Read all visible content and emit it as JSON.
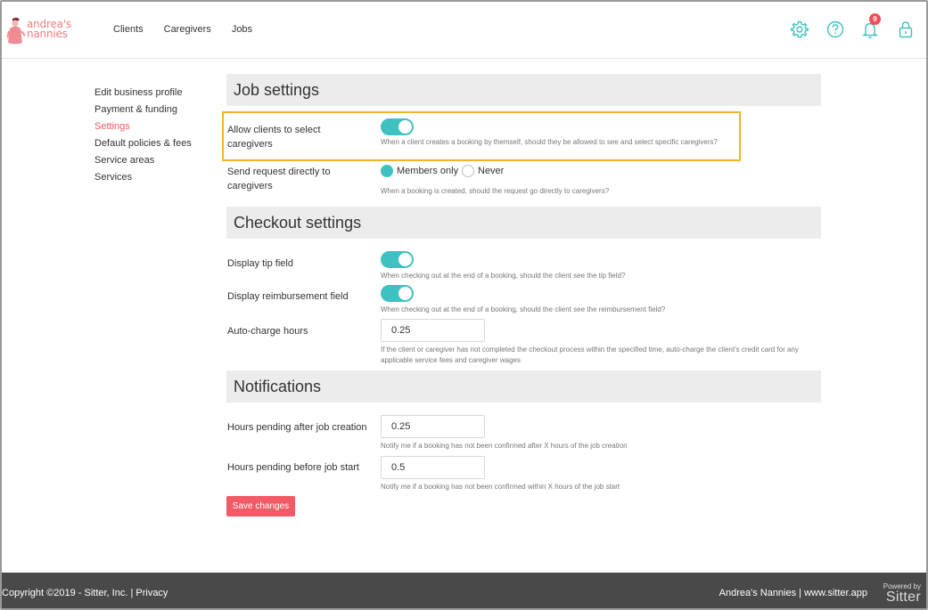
{
  "app": {
    "logo_text_1": "andrea's",
    "logo_text_2": "nannies"
  },
  "nav": {
    "items": [
      "Clients",
      "Caregivers",
      "Jobs"
    ]
  },
  "header": {
    "notification_count": "9",
    "icons": [
      "gear-icon",
      "help-icon",
      "bell-icon",
      "lock-icon"
    ],
    "accent": "#3ec1c0"
  },
  "sidebar": {
    "items": [
      {
        "label": "Edit business profile"
      },
      {
        "label": "Payment & funding"
      },
      {
        "label": "Settings",
        "active": true
      },
      {
        "label": "Default policies & fees"
      },
      {
        "label": "Service areas"
      },
      {
        "label": "Services"
      }
    ]
  },
  "job_settings": {
    "title": "Job settings",
    "allow_select": {
      "label_1": "Allow clients to select",
      "label_2": "caregivers",
      "enabled": true,
      "hint": "When a client creates a booking by themself, should they be allowed to see and select specific caregivers?"
    },
    "send_request": {
      "label_1": "Send request directly to",
      "label_2": "caregivers",
      "options": [
        "Members only",
        "Never"
      ],
      "selected": "Members only",
      "hint": "When a booking is created, should the request go directly to caregivers?"
    }
  },
  "checkout_settings": {
    "title": "Checkout settings",
    "tip": {
      "label": "Display tip field",
      "enabled": true,
      "hint": "When checking out at the end of a booking, should the client see the tip field?"
    },
    "reimbursement": {
      "label": "Display reimbursement field",
      "enabled": true,
      "hint": "When checking out at the end of a booking, should the client see the reimbursement field?"
    },
    "auto_charge": {
      "label": "Auto-charge hours",
      "value": "0.25",
      "hint_1": "If the client or caregiver has not completed the checkout process within the specified time, auto-charge the client's credit card for any",
      "hint_2": "applicable service fees and caregiver wages"
    }
  },
  "notifications": {
    "title": "Notifications",
    "after_creation": {
      "label": "Hours pending after job creation",
      "value": "0.25",
      "hint": "Notify me if a booking has not been confirmed after X hours of the job creation"
    },
    "before_start": {
      "label": "Hours pending before job start",
      "value": "0.5",
      "hint": "Notify me if a booking has not been confirmed within X hours of the job start"
    }
  },
  "actions": {
    "save_label": "Save changes"
  },
  "footer": {
    "copyright": "Copyright ©2019 - Sitter, Inc. | ",
    "privacy": "Privacy",
    "right": "Andrea's Nannies | www.sitter.app",
    "powered_by": "Powered by",
    "brand": "Sitter"
  }
}
